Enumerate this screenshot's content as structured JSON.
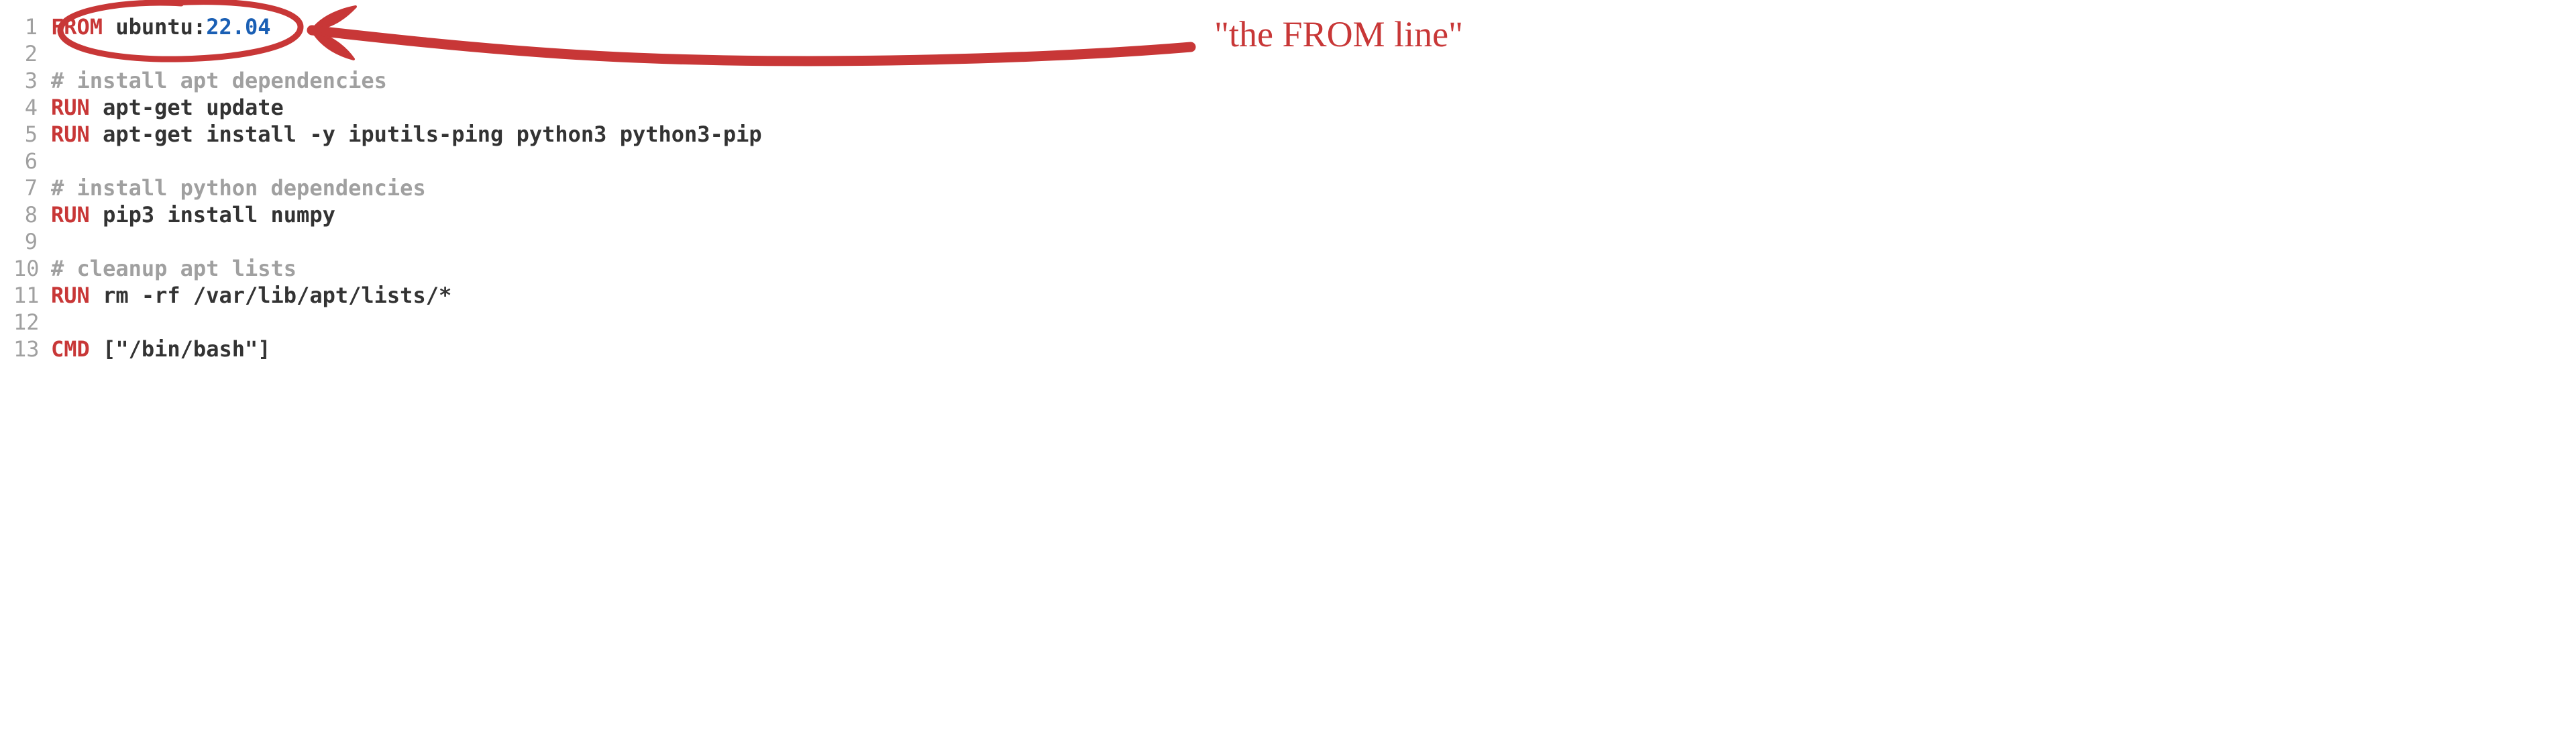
{
  "annotation": {
    "label": "\"the FROM line\""
  },
  "code": {
    "lines": [
      {
        "num": "1",
        "tokens": [
          {
            "cls": "tok-keyword",
            "text": "FROM"
          },
          {
            "cls": "tok-plain",
            "text": " ubuntu:"
          },
          {
            "cls": "tok-number",
            "text": "22.04"
          }
        ]
      },
      {
        "num": "2",
        "tokens": []
      },
      {
        "num": "3",
        "tokens": [
          {
            "cls": "tok-comment",
            "text": "# install apt dependencies"
          }
        ]
      },
      {
        "num": "4",
        "tokens": [
          {
            "cls": "tok-keyword",
            "text": "RUN"
          },
          {
            "cls": "tok-plain",
            "text": " apt-get update"
          }
        ]
      },
      {
        "num": "5",
        "tokens": [
          {
            "cls": "tok-keyword",
            "text": "RUN"
          },
          {
            "cls": "tok-plain",
            "text": " apt-get install -y iputils-ping python3 python3-pip"
          }
        ]
      },
      {
        "num": "6",
        "tokens": []
      },
      {
        "num": "7",
        "tokens": [
          {
            "cls": "tok-comment",
            "text": "# install python dependencies"
          }
        ]
      },
      {
        "num": "8",
        "tokens": [
          {
            "cls": "tok-keyword",
            "text": "RUN"
          },
          {
            "cls": "tok-plain",
            "text": " pip3 install numpy"
          }
        ]
      },
      {
        "num": "9",
        "tokens": []
      },
      {
        "num": "10",
        "tokens": [
          {
            "cls": "tok-comment",
            "text": "# cleanup apt lists"
          }
        ]
      },
      {
        "num": "11",
        "tokens": [
          {
            "cls": "tok-keyword",
            "text": "RUN"
          },
          {
            "cls": "tok-plain",
            "text": " rm -rf /var/lib/apt/lists/*"
          }
        ]
      },
      {
        "num": "12",
        "tokens": []
      },
      {
        "num": "13",
        "tokens": [
          {
            "cls": "tok-keyword",
            "text": "CMD"
          },
          {
            "cls": "tok-plain",
            "text": " ["
          },
          {
            "cls": "tok-string",
            "text": "\"/bin/bash\""
          },
          {
            "cls": "tok-plain",
            "text": "]"
          }
        ]
      }
    ]
  }
}
